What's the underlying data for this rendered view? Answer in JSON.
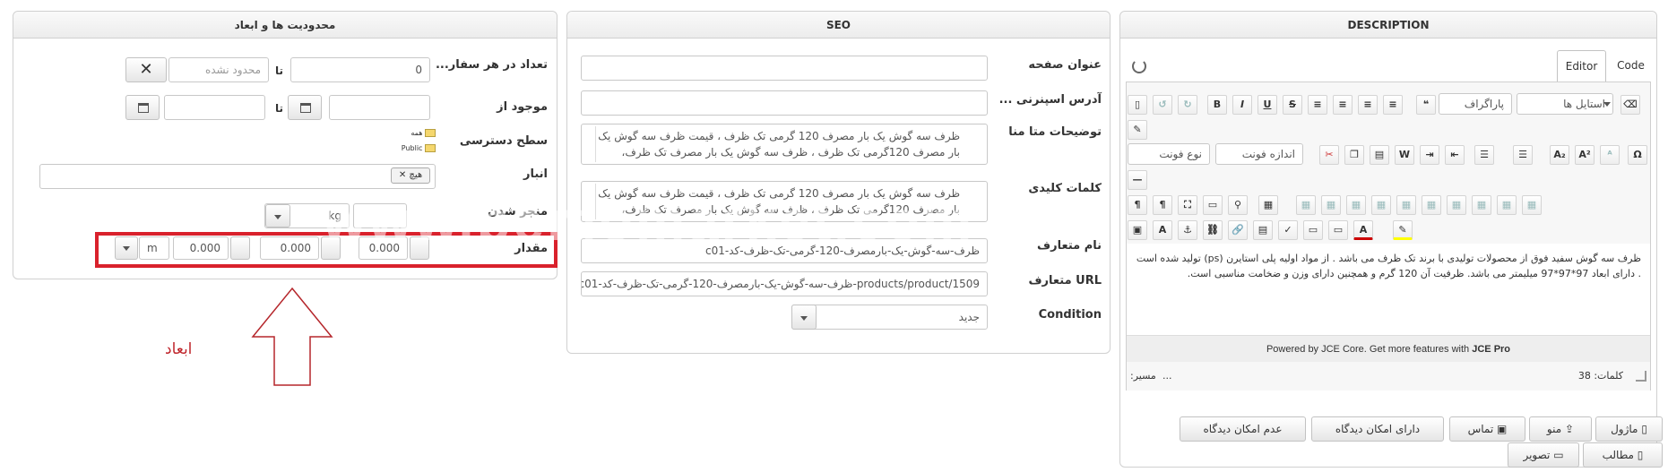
{
  "panels": {
    "limits": {
      "title": "محدودیت ها و ابعاد",
      "order_qty_label": "تعداد در هر سفار...",
      "order_qty_value": "0",
      "to_label_1": "تا",
      "unlimited_placeholder": "محدود نشده",
      "clear_icon": "✕",
      "available_from_label": "موجود از",
      "to_label_2": "تا",
      "access_label": "سطح دسترسی",
      "access_tree": [
        "همه",
        "Public"
      ],
      "warehouse_label": "انبار",
      "warehouse_tag": "هیچ",
      "weight_label": "منجر شدن",
      "weight_unit": "kg",
      "dimensions_label": "مقدار",
      "dimensions": [
        "0.000",
        "0.000",
        "0.000"
      ],
      "dimensions_unit": "m",
      "annotation": "ابعاد"
    },
    "seo": {
      "title": "SEO",
      "page_title_label": "عنوان صفحه",
      "alias_label": "آدرس اسپنرنی ...",
      "meta_desc_label": "توضیحات متا منا",
      "meta_desc_value": "ظرف سه گوش یک بار مصرف 120 گرمی تک ظرف ، قیمت ظرف سه گوش یک بار مصرف 120گرمی تک ظرف ، ظرف سه گوش یک بار مصرف تک ظرف،",
      "keywords_label": "کلمات کلیدی",
      "keywords_value": "ظرف سه گوش یک بار مصرف 120 گرمی تک ظرف ، قیمت ظرف سه گوش یک بار مصرف 120گرمی تک ظرف ، ظرف سه گوش یک بار مصرف تک ظرف،",
      "canonical_name_label": "نام متعارف",
      "canonical_name_value": "ظرف-سه-گوش-یک-بارمصرف-120-گرمی-تک-ظرف-کد-c01",
      "url_label": "URL متعارف",
      "url_value": "products/product/1509-ظرف-سه-گوش-یک-بارمصرف-120-گرمی-تک-ظرف-کد-c01",
      "condition_label": "Condition",
      "condition_value": "جدید"
    },
    "description": {
      "title": "DESCRIPTION",
      "tab_editor": "Editor",
      "tab_code": "Code",
      "style_select": "استایل ها",
      "paragraph_select": "پاراگراف",
      "font_size_select": "اندازه فونت",
      "font_family_select": "نوع فونت",
      "content": "ظرف سه گوش سفید فوق از محصولات تولیدی با برند تک ظرف می باشد . از مواد اولیه پلی استایرن (ps) تولید شده است . دارای ابعاد 97*97*97 میلیمتر می باشد. ظرفیت آن 120 گرم و همچنین دارای وزن و ضخامت مناسبی است.",
      "powered_prefix": "Powered by JCE Core. Get more features with ",
      "powered_brand": "JCE Pro",
      "path_label": "مسیر:",
      "path_value": "...",
      "word_count": "کلمات: 38",
      "buttons_row1": [
        "ماژول",
        "منو",
        "تماس",
        "دارای امکان دیدگاه",
        "عدم امکان دیدگاه"
      ],
      "buttons_row2": [
        "مطالب",
        "تصویر"
      ]
    }
  },
  "watermark": "www.bemomarket.com",
  "colors": {
    "highlight_border": "#d9212c",
    "annotation": "#c0272d",
    "arrow": "#b5262b"
  }
}
